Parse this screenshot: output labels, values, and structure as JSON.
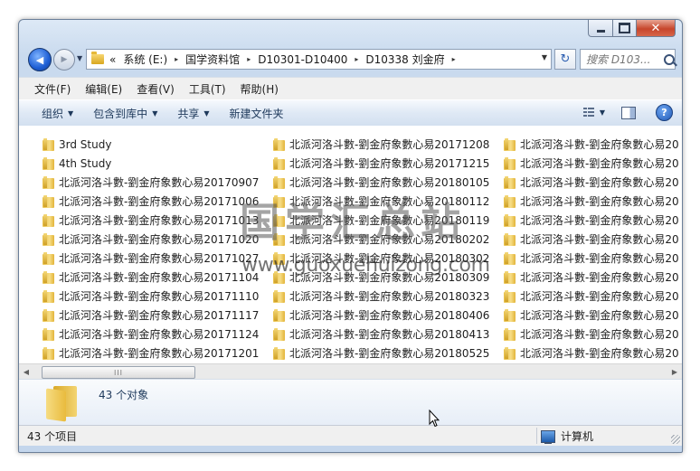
{
  "window": {
    "caption_buttons": {
      "minimize": "–",
      "maximize": "□",
      "close": "✕"
    }
  },
  "nav": {
    "back_glyph": "◀",
    "forward_glyph": "▶",
    "dropdown_glyph": "▼"
  },
  "address": {
    "prefix": "«",
    "crumbs": [
      "系统 (E:)",
      "国学资料馆",
      "D10301-D10400",
      "D10338 刘金府"
    ],
    "separator": "▸",
    "dropdown_glyph": "▼"
  },
  "refresh_glyph": "↻",
  "search": {
    "placeholder": "搜索 D103..."
  },
  "menubar": {
    "items": [
      "文件(F)",
      "编辑(E)",
      "查看(V)",
      "工具(T)",
      "帮助(H)"
    ]
  },
  "commandbar": {
    "items": [
      {
        "label": "组织",
        "has_arrow": true
      },
      {
        "label": "包含到库中",
        "has_arrow": true
      },
      {
        "label": "共享",
        "has_arrow": true
      },
      {
        "label": "新建文件夹",
        "has_arrow": false
      }
    ],
    "arrow_glyph": "▼",
    "help_glyph": "?"
  },
  "files": {
    "column1": [
      "3rd Study",
      "4th Study",
      "北派河洛斗數-劉金府象數心易20170907",
      "北派河洛斗數-劉金府象數心易20171006",
      "北派河洛斗數-劉金府象數心易20171013",
      "北派河洛斗數-劉金府象數心易20171020",
      "北派河洛斗數-劉金府象數心易20171027",
      "北派河洛斗數-劉金府象數心易20171104",
      "北派河洛斗數-劉金府象數心易20171110",
      "北派河洛斗數-劉金府象數心易20171117",
      "北派河洛斗數-劉金府象數心易20171124",
      "北派河洛斗數-劉金府象數心易20171201"
    ],
    "column2": [
      "北派河洛斗數-劉金府象數心易20171208",
      "北派河洛斗數-劉金府象數心易20171215",
      "北派河洛斗數-劉金府象數心易20180105",
      "北派河洛斗數-劉金府象數心易20180112",
      "北派河洛斗數-劉金府象數心易20180119",
      "北派河洛斗數-劉金府象數心易20180202",
      "北派河洛斗數-劉金府象數心易20180302",
      "北派河洛斗數-劉金府象數心易20180309",
      "北派河洛斗數-劉金府象數心易20180323",
      "北派河洛斗數-劉金府象數心易20180406",
      "北派河洛斗數-劉金府象數心易20180413",
      "北派河洛斗數-劉金府象數心易20180525"
    ],
    "column3": [
      "北派河洛斗數-劉金府象數心易20",
      "北派河洛斗數-劉金府象數心易20",
      "北派河洛斗數-劉金府象數心易20",
      "北派河洛斗數-劉金府象數心易20",
      "北派河洛斗數-劉金府象數心易20",
      "北派河洛斗數-劉金府象數心易20",
      "北派河洛斗數-劉金府象數心易20",
      "北派河洛斗數-劉金府象數心易20",
      "北派河洛斗數-劉金府象數心易20",
      "北派河洛斗數-劉金府象數心易20",
      "北派河洛斗數-劉金府象數心易20",
      "北派河洛斗數-劉金府象數心易20"
    ]
  },
  "scrollbar": {
    "left_glyph": "◀",
    "right_glyph": "▶",
    "thumb_grip": "III"
  },
  "details": {
    "object_count": "43 个对象"
  },
  "status": {
    "item_count": "43 个项目",
    "location": "计算机"
  },
  "watermark": {
    "text": "国学汇总站",
    "url": "www.guoxuehuizong.com"
  },
  "colors": {
    "window_frame": "#c4d6ec",
    "close_button": "#c7462c",
    "folder": "#e9bb3d"
  }
}
